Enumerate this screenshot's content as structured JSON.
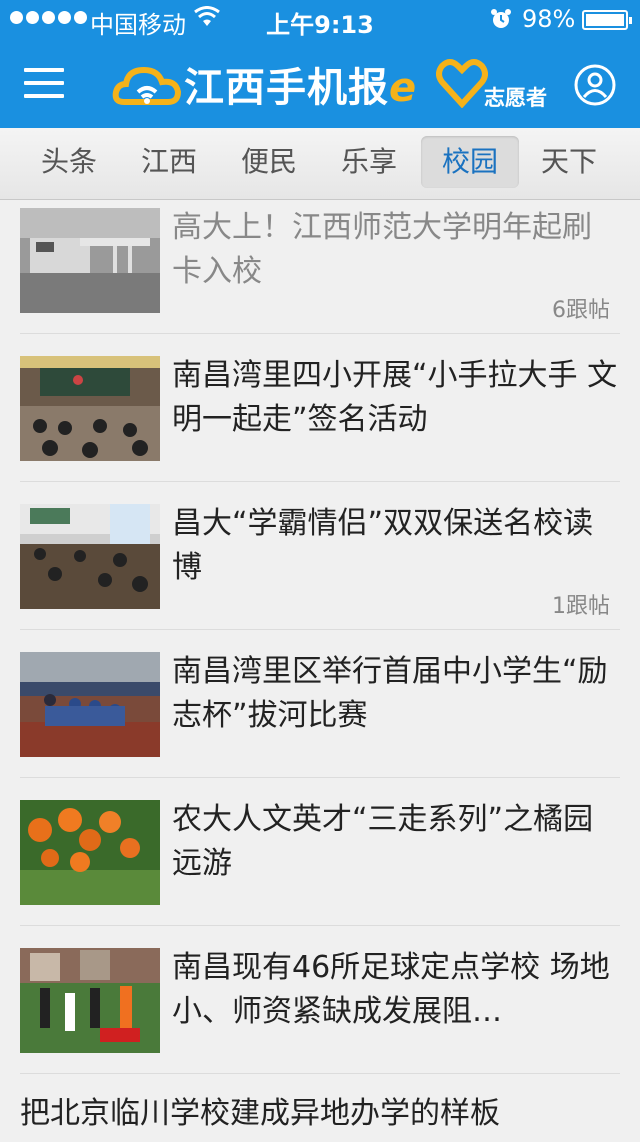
{
  "status_bar": {
    "carrier": "中国移动",
    "time": "上午9:13",
    "battery": "98%",
    "battery_level": 0.98
  },
  "navbar": {
    "logo_text": "江西手机报",
    "logo_accent": "e",
    "volunteer_label": "志愿者"
  },
  "tabs": [
    {
      "label": "头条"
    },
    {
      "label": "江西"
    },
    {
      "label": "便民"
    },
    {
      "label": "乐享"
    },
    {
      "label": "校园",
      "active": true
    },
    {
      "label": "天下"
    }
  ],
  "news": [
    {
      "title": "高大上！江西师范大学明年起刷卡入校",
      "replies": "6跟帖",
      "read": true,
      "thumb": "campus-gate-turnstile"
    },
    {
      "title": "南昌湾里四小开展“小手拉大手 文明一起走”签名活动",
      "replies": "",
      "thumb": "classroom-students"
    },
    {
      "title": "昌大“学霸情侣”双双保送名校读博",
      "replies": "1跟帖",
      "thumb": "study-room"
    },
    {
      "title": "南昌湾里区举行首届中小学生“励志杯”拔河比赛",
      "replies": "",
      "thumb": "tug-of-war"
    },
    {
      "title": "农大人文英才“三走系列”之橘园远游",
      "replies": "",
      "thumb": "orange-orchard"
    },
    {
      "title": "南昌现有46所足球定点学校 场地小、师资紧缺成发展阻…",
      "replies": "",
      "thumb": "soccer-kids"
    }
  ],
  "last_item": {
    "title": "把北京临川学校建成异地办学的样板"
  },
  "colors": {
    "brand": "#1a90e0",
    "accent": "#f5b21a",
    "active_tab": "#1a72c0"
  }
}
